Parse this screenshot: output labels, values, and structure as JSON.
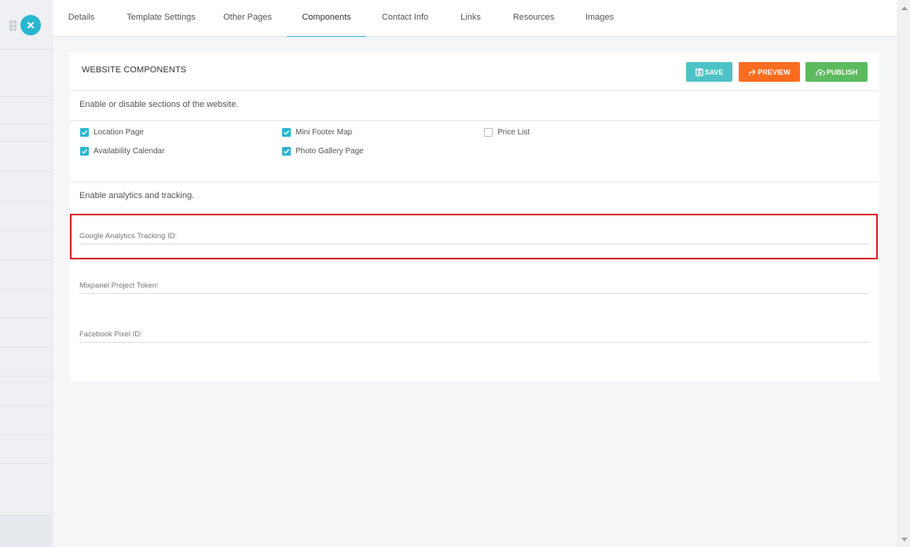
{
  "tabs": [
    {
      "label": "Details"
    },
    {
      "label": "Template Settings"
    },
    {
      "label": "Other Pages"
    },
    {
      "label": "Components",
      "active": true
    },
    {
      "label": "Contact Info"
    },
    {
      "label": "Links"
    },
    {
      "label": "Resources"
    },
    {
      "label": "Images"
    }
  ],
  "card": {
    "title": "WEBSITE COMPONENTS",
    "buttons": {
      "save": "SAVE",
      "preview": "PREVIEW",
      "publish": "PUBLISH"
    },
    "components_intro": "Enable or disable sections of the website.",
    "components": [
      {
        "label": "Location Page",
        "checked": true
      },
      {
        "label": "Mini Footer Map",
        "checked": true
      },
      {
        "label": "Price List",
        "checked": false
      },
      {
        "label": "Availability Calendar",
        "checked": true
      },
      {
        "label": "Photo Gallery Page",
        "checked": true
      }
    ],
    "analytics_intro": "Enable analytics and tracking.",
    "fields": [
      {
        "label": "Google Analytics Tracking ID:",
        "value": ""
      },
      {
        "label": "Mixpanel Project Token:",
        "value": ""
      },
      {
        "label": "Facebook Pixel ID:",
        "value": ""
      }
    ]
  },
  "colors": {
    "accent": "#29b6d1",
    "save": "#4dc3c7",
    "preview": "#fb6c1e",
    "publish": "#5cba5f",
    "highlight": "#d81b1b"
  },
  "icons": {
    "close": "close-icon",
    "grid": "grid-icon",
    "save": "floppy-icon",
    "preview": "share-icon",
    "publish": "cloud-upload-icon"
  }
}
